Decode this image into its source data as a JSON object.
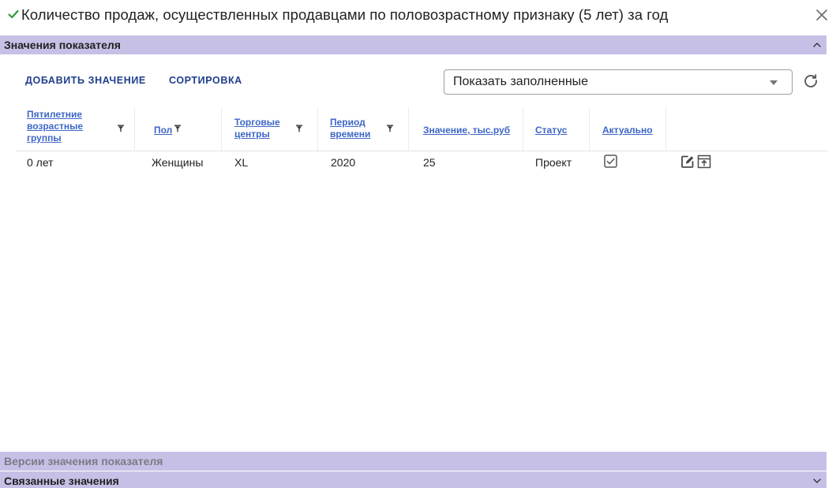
{
  "window": {
    "title": "Количество продаж, осуществленных продавцами по половозрастному признаку (5 лет) за год",
    "title_icon": "check-icon",
    "close_icon": "close-icon"
  },
  "sections": {
    "values": {
      "label": "Значения показателя",
      "state": "expanded",
      "icon": "chevron-up-icon"
    },
    "versions": {
      "label": "Версии значения показателя"
    },
    "related": {
      "label": "Связанные значения",
      "state": "collapsed",
      "icon": "chevron-down-icon"
    }
  },
  "toolbar": {
    "add_label": "ДОБАВИТЬ ЗНАЧЕНИЕ",
    "sort_label": "СОРТИРОВКА",
    "filter_select_value": "Показать заполненные",
    "refresh_icon": "refresh-icon"
  },
  "table": {
    "columns": {
      "age_group": "Пятилетние возрастные группы",
      "sex": "Пол",
      "mall": "Торговые центры",
      "period": "Период времени",
      "value": "Значение, тыс.руб",
      "status": "Статус",
      "actual": "Актуально"
    },
    "rows": [
      {
        "age_group": "0 лет",
        "sex": "Женщины",
        "mall": "XL",
        "period": "2020",
        "value": "25",
        "status": "Проект",
        "actual": true,
        "actions": [
          "edit-icon",
          "archive-icon"
        ]
      }
    ]
  },
  "colors": {
    "section_header_bg": "#c7c0e6",
    "accent_link": "#3d66c6",
    "toolbar_text": "#1f3e8c",
    "check_green": "#2e9b3a"
  }
}
